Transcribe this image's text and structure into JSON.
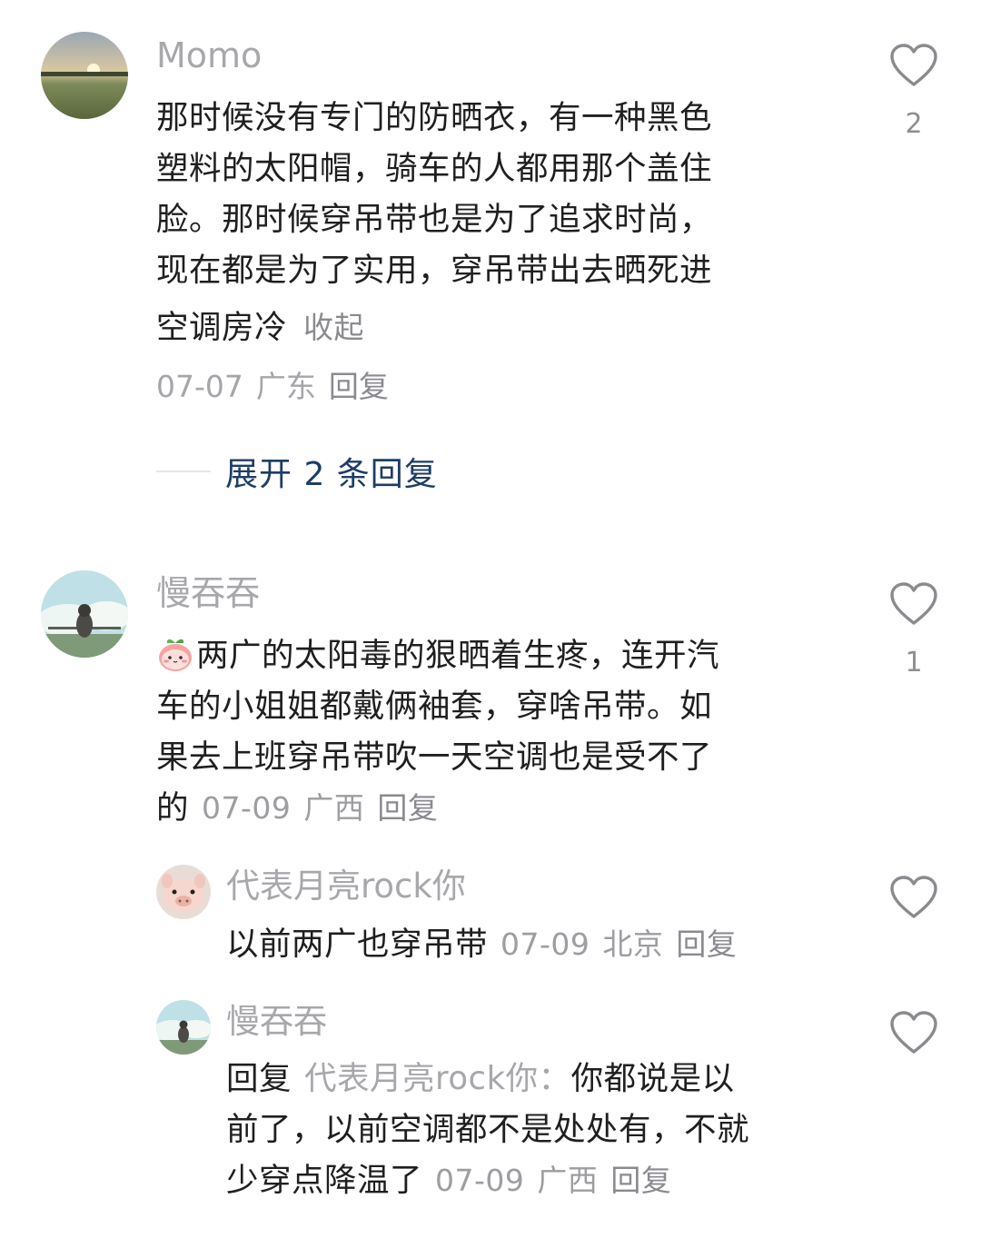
{
  "comments": [
    {
      "username": "Momo",
      "lines": [
        "那时候没有专门的防晒衣，有一种黑色",
        "塑料的太阳帽，骑车的人都用那个盖住",
        "脸。那时候穿吊带也是为了追求时尚，",
        "现在都是为了实用，穿吊带出去晒死进",
        "空调房冷"
      ],
      "fold_label": "收起",
      "date": "07-07",
      "location": "广东",
      "reply_label": "回复",
      "like_count": "2",
      "expand_label": "展开 2 条回复"
    },
    {
      "username": "慢吞吞",
      "lines": [
        "两广的太阳毒的狠晒着生疼，连开汽",
        "车的小姐姐都戴俩袖套，穿啥吊带。如",
        "果去上班穿吊带吹一天空调也是受不了",
        "的"
      ],
      "date": "07-09",
      "location": "广西",
      "reply_label": "回复",
      "like_count": "1",
      "replies": [
        {
          "username": "代表月亮rock你",
          "text": "以前两广也穿吊带",
          "date": "07-09",
          "location": "北京",
          "reply_label": "回复"
        },
        {
          "username": "慢吞吞",
          "prefix": "回复",
          "ref_name": "代表月亮rock你：",
          "lines": [
            "你都说是以",
            "前了，以前空调都不是处处有，不就",
            "少穿点降温了"
          ],
          "date": "07-09",
          "location": "广西",
          "reply_label": "回复"
        }
      ]
    }
  ]
}
